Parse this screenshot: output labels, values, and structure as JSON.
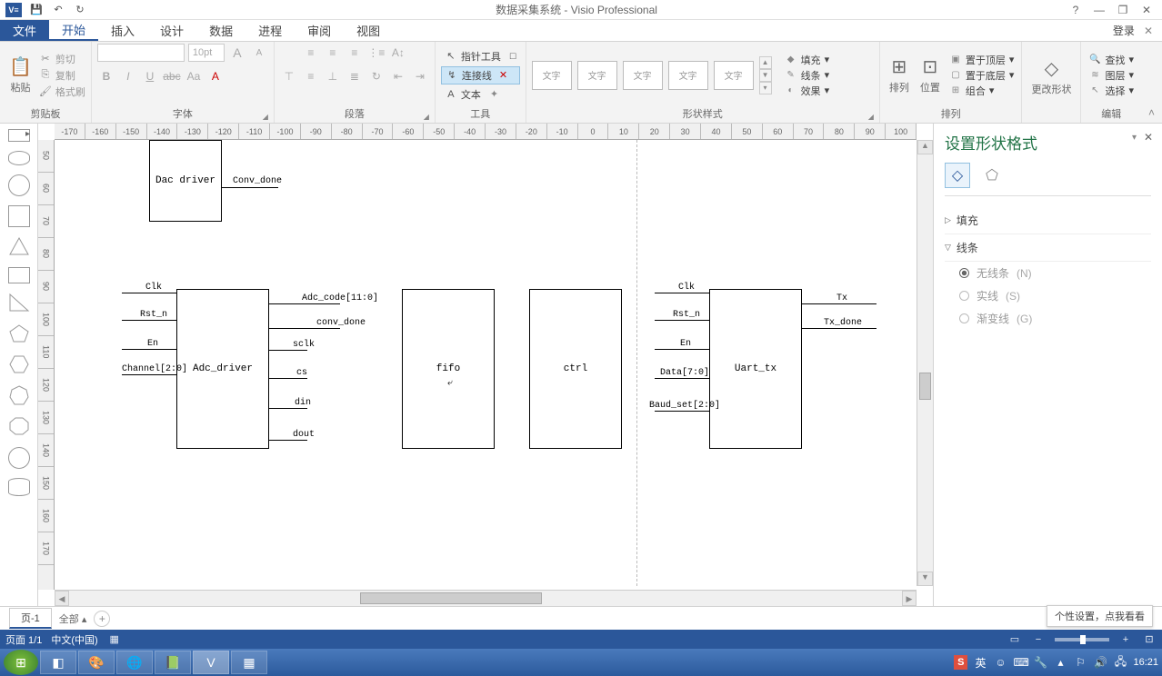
{
  "title": "数据采集系统 - Visio Professional",
  "qat": {
    "save": "💾",
    "undo": "↶",
    "redo": "↻"
  },
  "win": {
    "help": "?",
    "min": "—",
    "restore": "❐",
    "close": "✕"
  },
  "tabs": {
    "file": "文件",
    "home": "开始",
    "insert": "插入",
    "design": "设计",
    "data": "数据",
    "process": "进程",
    "review": "审阅",
    "view": "视图"
  },
  "login": "登录",
  "ribbon": {
    "clipboard": {
      "label": "剪贴板",
      "paste": "粘贴",
      "cut": "剪切",
      "copy": "复制",
      "formatpainter": "格式刷"
    },
    "font": {
      "label": "字体",
      "size": "10pt",
      "bold": "B",
      "italic": "I",
      "underline": "U",
      "strike": "abc",
      "case": "Aa",
      "grow": "A",
      "shrink": "A"
    },
    "paragraph": {
      "label": "段落"
    },
    "tools": {
      "label": "工具",
      "pointer": "指针工具",
      "connector": "连接线",
      "text": "文本"
    },
    "styles": {
      "label": "形状样式",
      "swatch": "文字",
      "fill": "填充",
      "line": "线条",
      "effects": "效果"
    },
    "arrange": {
      "label": "排列",
      "align": "排列",
      "position": "位置",
      "front": "置于顶层",
      "back": "置于底层",
      "group": "组合"
    },
    "change": "更改形状",
    "edit": {
      "label": "编辑",
      "find": "查找",
      "layers": "图层",
      "select": "选择"
    }
  },
  "ruler_h": [
    "-170",
    "-160",
    "-150",
    "-140",
    "-130",
    "-120",
    "-110",
    "-100",
    "-90",
    "-80",
    "-70",
    "-60",
    "-50",
    "-40",
    "-30",
    "-20",
    "-10",
    "0",
    "10",
    "20",
    "30",
    "40",
    "50",
    "60",
    "70",
    "80",
    "90",
    "100"
  ],
  "ruler_v": [
    "50",
    "60",
    "70",
    "80",
    "90",
    "100",
    "110",
    "120",
    "130",
    "140",
    "150",
    "160",
    "170"
  ],
  "diagram": {
    "dac": "Dac driver",
    "conv_done": "Conv_done",
    "adc": {
      "name": "Adc_driver",
      "in": [
        "Clk",
        "Rst_n",
        "En",
        "Channel[2:0]"
      ],
      "out": [
        "Adc_code[11:0]",
        "conv_done",
        "sclk",
        "cs",
        "din",
        "dout"
      ]
    },
    "fifo": "fifo",
    "ctrl": "ctrl",
    "uart": {
      "name": "Uart_tx",
      "in": [
        "Clk",
        "Rst_n",
        "En",
        "Data[7:0]",
        "Baud_set[2:0]"
      ],
      "out": [
        "Tx",
        "Tx_done"
      ]
    }
  },
  "format_pane": {
    "title": "设置形状格式",
    "fill": "填充",
    "line": "线条",
    "noline": "无线条",
    "noline_accel": "(N)",
    "solid": "实线",
    "solid_accel": "(S)",
    "gradient": "渐变线",
    "gradient_accel": "(G)"
  },
  "pages": {
    "page1": "页-1",
    "all": "全部",
    "tooltip": "个性设置，点我看看"
  },
  "status": {
    "page": "页面 1/1",
    "lang": "中文(中国)"
  },
  "tray": {
    "ime_s": "S",
    "ime_eng": "英",
    "time": "16:21"
  }
}
